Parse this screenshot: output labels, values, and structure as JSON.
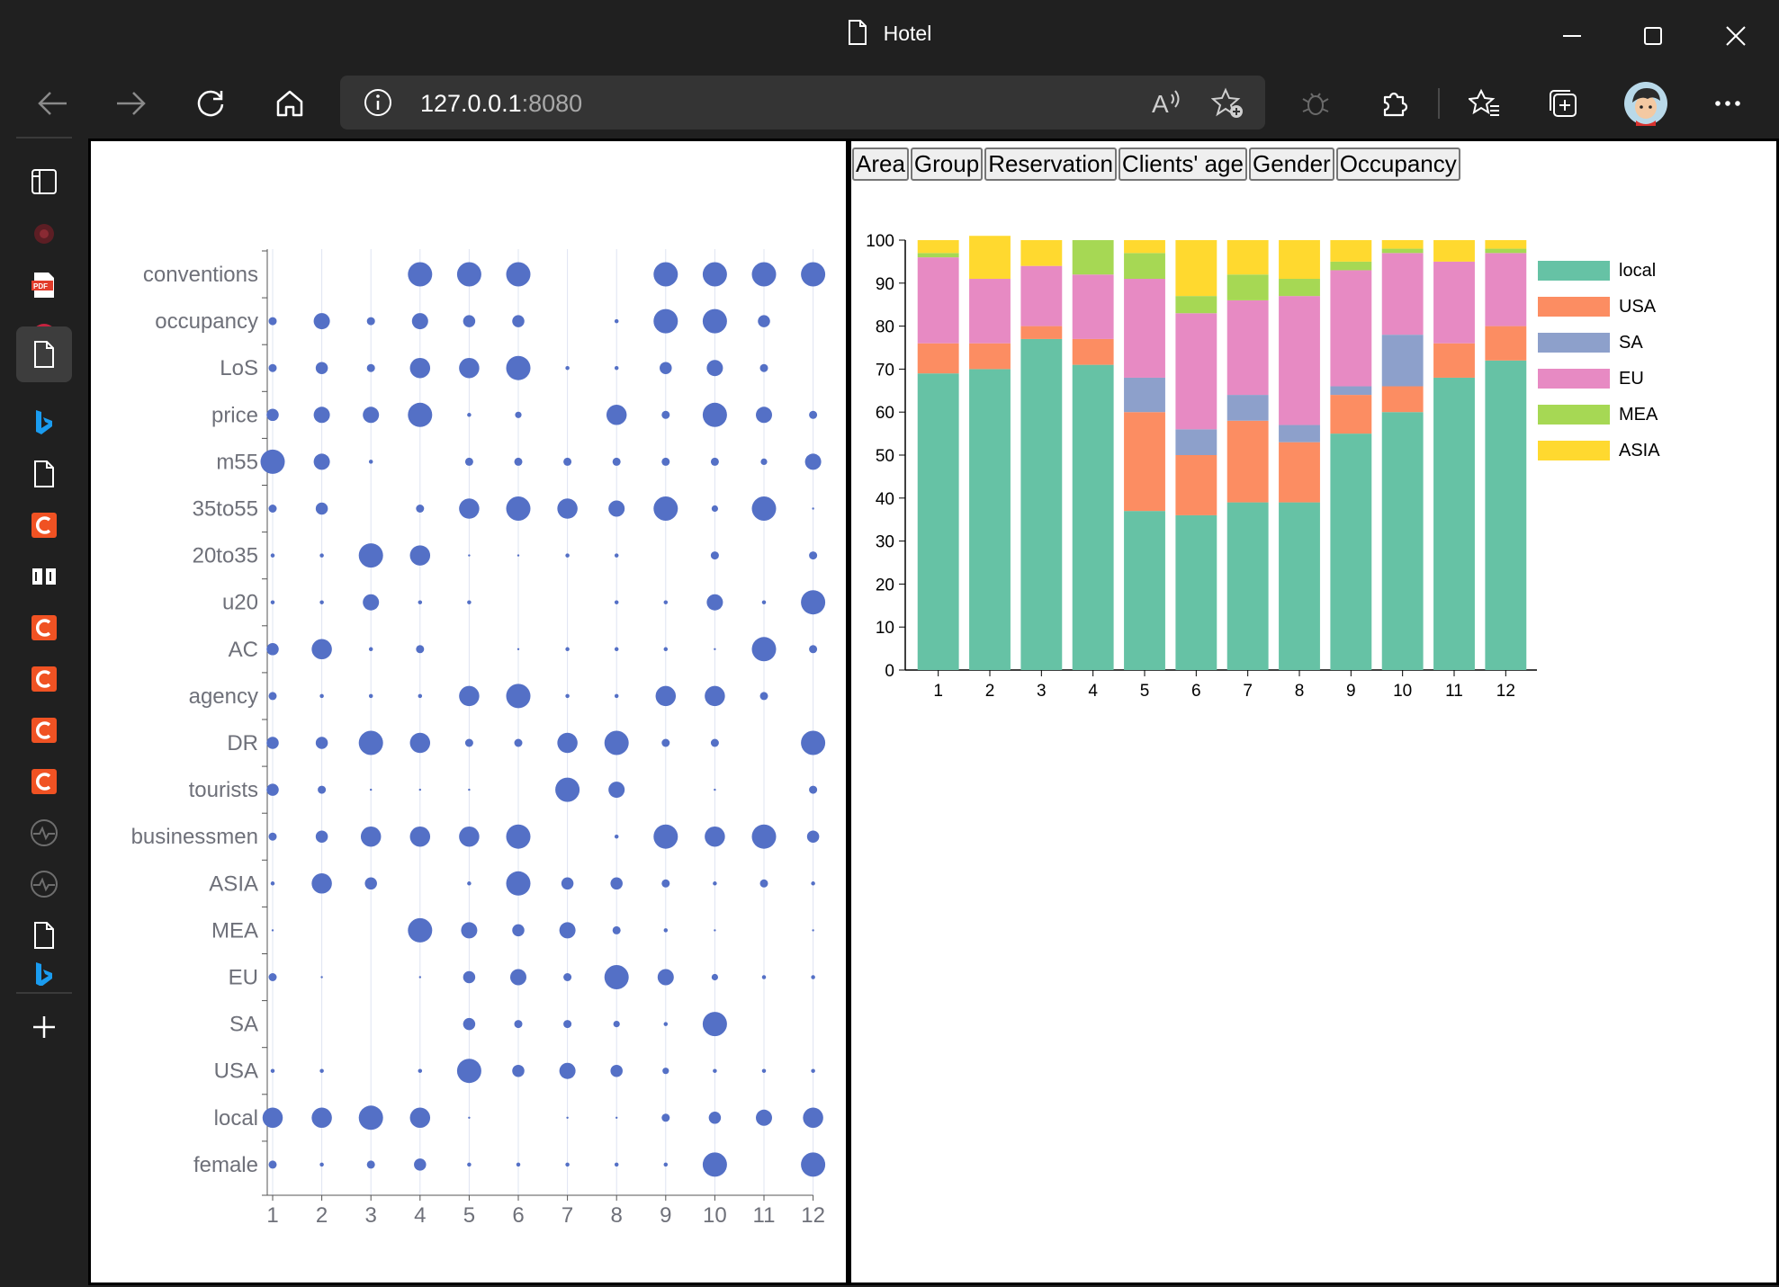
{
  "window": {
    "title": "Hotel"
  },
  "address_bar": {
    "host": "127.0.0.1",
    "port": ":8080"
  },
  "tabs": [
    "Area",
    "Group",
    "Reservation",
    "Clients' age",
    "Gender",
    "Occupancy"
  ],
  "chart_data": [
    {
      "type": "scatter",
      "title": "",
      "x": [
        1,
        2,
        3,
        4,
        5,
        6,
        7,
        8,
        9,
        10,
        11,
        12
      ],
      "categories": [
        "conventions",
        "occupancy",
        "LoS",
        "price",
        "m55",
        "35to55",
        "20to35",
        "u20",
        "AC",
        "agency",
        "DR",
        "tourists",
        "businessmen",
        "ASIA",
        "MEA",
        "EU",
        "SA",
        "USA",
        "local",
        "female"
      ],
      "sizes": [
        [
          0,
          0,
          0,
          3,
          3,
          3,
          0,
          0,
          3,
          3,
          3,
          3
        ],
        [
          1,
          2,
          1,
          2,
          1.5,
          1.5,
          0,
          0.5,
          3,
          3,
          1.5,
          0
        ],
        [
          1,
          1.5,
          1,
          2.5,
          2.5,
          3,
          0.5,
          0.5,
          1.5,
          2,
          1,
          0
        ],
        [
          1.5,
          2,
          2,
          3,
          0.5,
          0.8,
          0,
          2.5,
          1,
          3,
          2,
          1
        ],
        [
          3,
          2,
          0.5,
          0,
          1,
          1,
          1,
          1,
          1,
          1,
          0.8,
          2
        ],
        [
          1,
          1.5,
          0,
          1,
          2.5,
          3,
          2.5,
          2,
          3,
          0.8,
          3,
          0.2
        ],
        [
          0.5,
          0.5,
          3,
          2.5,
          0.2,
          0.2,
          0.5,
          0.5,
          0,
          1,
          0,
          1
        ],
        [
          0.5,
          0.5,
          2,
          0.5,
          0.5,
          0,
          0,
          0.5,
          0.5,
          2,
          0.5,
          3
        ],
        [
          1.5,
          2.5,
          0.5,
          1,
          0,
          0.2,
          0.5,
          0.5,
          0.5,
          0.2,
          3,
          1
        ],
        [
          1,
          0.5,
          0.5,
          0.5,
          2.5,
          3,
          0.5,
          0.5,
          2.5,
          2.5,
          1,
          0
        ],
        [
          1.5,
          1.5,
          3,
          2.5,
          1,
          1,
          2.5,
          3,
          1,
          1,
          0,
          3
        ],
        [
          1.5,
          1,
          0.2,
          0.2,
          0.2,
          0,
          3,
          2,
          0,
          0.2,
          0,
          1
        ],
        [
          1,
          1.5,
          2.5,
          2.5,
          2.5,
          3,
          0,
          0.5,
          3,
          2.5,
          3,
          1.5
        ],
        [
          0.5,
          2.5,
          1.5,
          0,
          0.5,
          3,
          1.5,
          1.5,
          1,
          0.5,
          1,
          0.5
        ],
        [
          0.2,
          0,
          0,
          3,
          2,
          1.5,
          2,
          1,
          0.5,
          0.2,
          0,
          0.2
        ],
        [
          1,
          0.2,
          0,
          0.2,
          1.5,
          2,
          1,
          3,
          2,
          0.8,
          0.5,
          0.5
        ],
        [
          0,
          0,
          0,
          0,
          1.5,
          1,
          1,
          0.8,
          0.5,
          3,
          0,
          0
        ],
        [
          0.5,
          0.5,
          0,
          0.5,
          3,
          1.5,
          2,
          1.5,
          0.8,
          0.5,
          0.5,
          0.5
        ],
        [
          2.5,
          2.5,
          3,
          2.5,
          0.2,
          0,
          0.2,
          0.2,
          1,
          1.5,
          2,
          2.5
        ],
        [
          1,
          0.5,
          1,
          1.5,
          0.5,
          0.5,
          0.5,
          0.5,
          0.5,
          3,
          0,
          3
        ]
      ]
    },
    {
      "type": "bar",
      "stacked": true,
      "title": "",
      "categories": [
        "1",
        "2",
        "3",
        "4",
        "5",
        "6",
        "7",
        "8",
        "9",
        "10",
        "11",
        "12"
      ],
      "ylim": [
        0,
        100
      ],
      "yticks": [
        0,
        10,
        20,
        30,
        40,
        50,
        60,
        70,
        80,
        90,
        100
      ],
      "legend_position": "right",
      "series": [
        {
          "name": "local",
          "color": "#66c2a5",
          "values": [
            69,
            70,
            77,
            71,
            37,
            36,
            39,
            39,
            55,
            60,
            68,
            72
          ]
        },
        {
          "name": "USA",
          "color": "#fc8d62",
          "values": [
            7,
            6,
            3,
            6,
            23,
            14,
            19,
            14,
            9,
            6,
            8,
            8
          ]
        },
        {
          "name": "SA",
          "color": "#8da0cb",
          "values": [
            0,
            0,
            0,
            0,
            8,
            6,
            6,
            4,
            2,
            12,
            0,
            0
          ]
        },
        {
          "name": "EU",
          "color": "#e78ac3",
          "values": [
            20,
            15,
            14,
            15,
            23,
            27,
            22,
            30,
            27,
            19,
            19,
            17
          ]
        },
        {
          "name": "MEA",
          "color": "#a6d854",
          "values": [
            1,
            0,
            0,
            8,
            6,
            4,
            6,
            4,
            2,
            1,
            0,
            1
          ]
        },
        {
          "name": "ASIA",
          "color": "#ffd92f",
          "values": [
            3,
            10,
            6,
            0,
            3,
            13,
            8,
            9,
            5,
            2,
            5,
            2
          ]
        }
      ]
    }
  ],
  "colors": {
    "dot": "#5470c6",
    "chrome": "#202020"
  }
}
